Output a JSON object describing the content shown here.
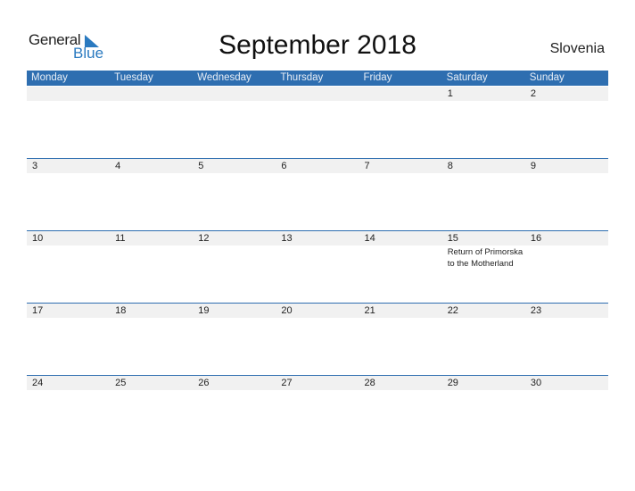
{
  "logo": {
    "word1": "General",
    "word2": "Blue"
  },
  "title": "September 2018",
  "country": "Slovenia",
  "weekdays": [
    "Monday",
    "Tuesday",
    "Wednesday",
    "Thursday",
    "Friday",
    "Saturday",
    "Sunday"
  ],
  "weeks": [
    {
      "days": [
        "",
        "",
        "",
        "",
        "",
        "1",
        "2"
      ],
      "events": [
        "",
        "",
        "",
        "",
        "",
        "",
        ""
      ]
    },
    {
      "days": [
        "3",
        "4",
        "5",
        "6",
        "7",
        "8",
        "9"
      ],
      "events": [
        "",
        "",
        "",
        "",
        "",
        "",
        ""
      ]
    },
    {
      "days": [
        "10",
        "11",
        "12",
        "13",
        "14",
        "15",
        "16"
      ],
      "events": [
        "",
        "",
        "",
        "",
        "",
        "Return of Primorska to the Motherland",
        ""
      ]
    },
    {
      "days": [
        "17",
        "18",
        "19",
        "20",
        "21",
        "22",
        "23"
      ],
      "events": [
        "",
        "",
        "",
        "",
        "",
        "",
        ""
      ]
    },
    {
      "days": [
        "24",
        "25",
        "26",
        "27",
        "28",
        "29",
        "30"
      ],
      "events": [
        "",
        "",
        "",
        "",
        "",
        "",
        ""
      ]
    }
  ],
  "colors": {
    "header": "#2e6eb0",
    "accent": "#2a7ac0",
    "band": "#f1f1f1"
  }
}
